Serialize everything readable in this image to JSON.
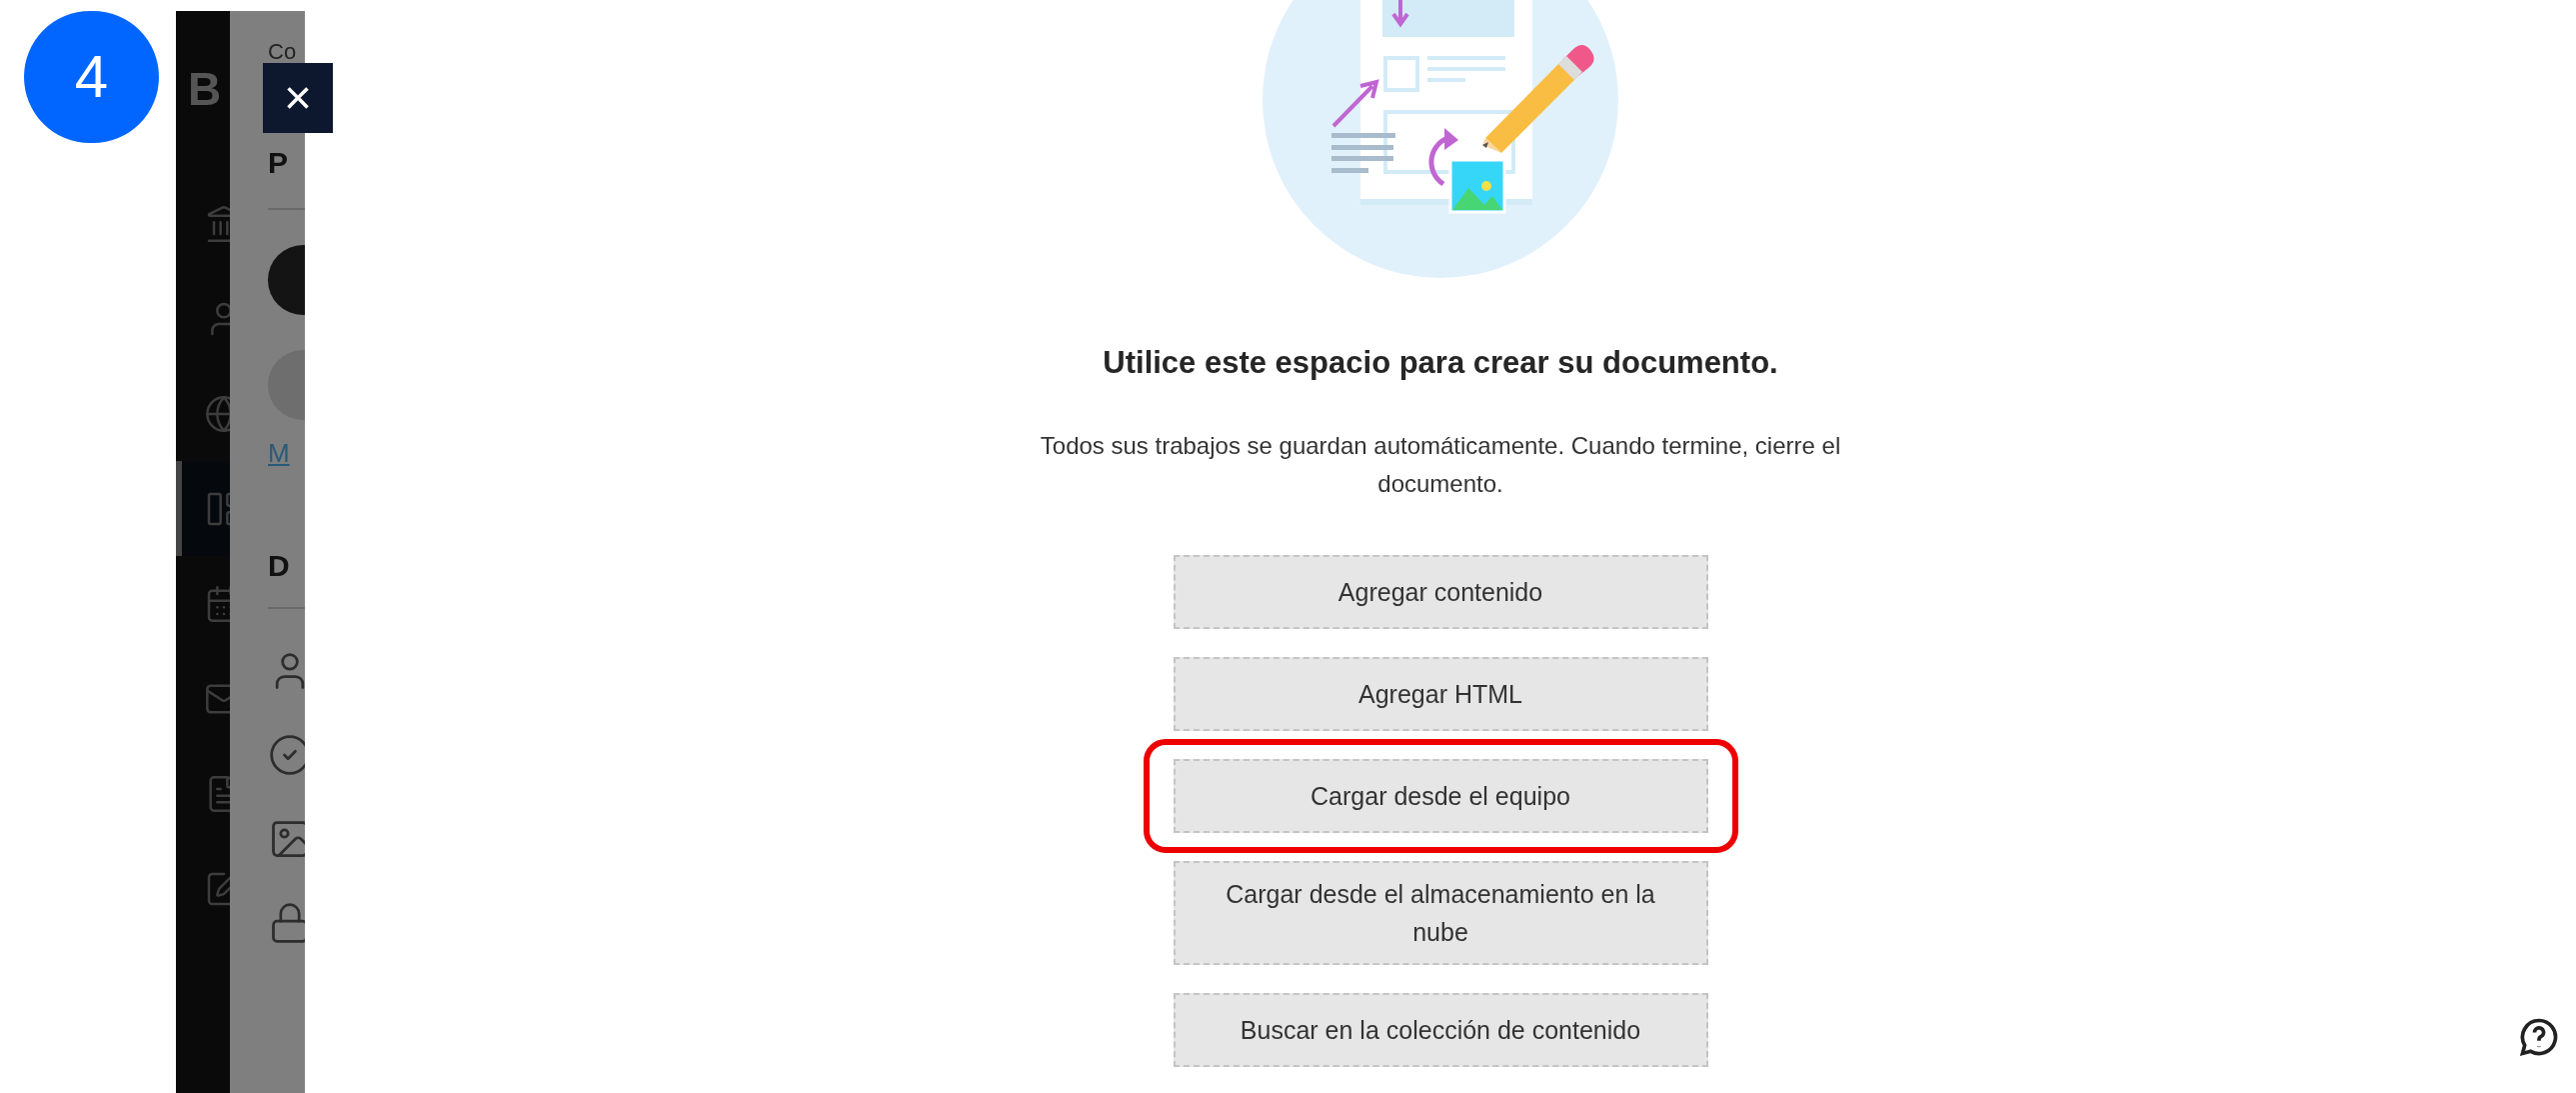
{
  "step_badge": "4",
  "close_button": "×",
  "sidebar": {
    "logo": "B",
    "items": [
      {
        "kind": "bank",
        "selected": false
      },
      {
        "kind": "person",
        "selected": false
      },
      {
        "kind": "globe",
        "selected": false
      },
      {
        "kind": "layout",
        "selected": true
      },
      {
        "kind": "calendar",
        "selected": false
      },
      {
        "kind": "mail",
        "selected": false
      },
      {
        "kind": "document",
        "selected": false
      },
      {
        "kind": "edit",
        "selected": false
      }
    ]
  },
  "panel": {
    "top_text": "Co",
    "heading_1": "P",
    "link": "M",
    "heading_2": "D",
    "items": [
      {
        "kind": "person"
      },
      {
        "kind": "check"
      },
      {
        "kind": "image"
      },
      {
        "kind": "lock"
      }
    ]
  },
  "main": {
    "title": "Utilice este espacio para crear su documento.",
    "description": "Todos sus trabajos se guardan automáticamente. Cuando termine, cierre el documento.",
    "actions": [
      {
        "label": "Agregar contenido",
        "highlighted": false
      },
      {
        "label": "Agregar HTML",
        "highlighted": false
      },
      {
        "label": "Cargar desde el equipo",
        "highlighted": true
      },
      {
        "label": "Cargar desde el almacenamiento en la nube",
        "highlighted": false
      },
      {
        "label": "Buscar en la colección de contenido",
        "highlighted": false
      }
    ]
  }
}
